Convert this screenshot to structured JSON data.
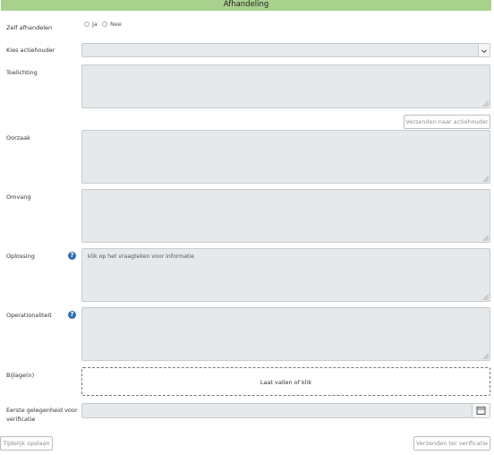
{
  "header": {
    "title": "Afhandeling"
  },
  "self_handle": {
    "label": "Zelf afhandelen",
    "options": [
      "Ja",
      "Nee"
    ]
  },
  "actionholder": {
    "label": "Kies actiehouder",
    "value": ""
  },
  "explanation": {
    "label": "Toelichting",
    "value": ""
  },
  "send_to_actionholder": {
    "label": "Verzenden naar actiehouder"
  },
  "cause": {
    "label": "Oorzaak",
    "value": ""
  },
  "scope": {
    "label": "Omvang",
    "value": ""
  },
  "solution": {
    "label": "Oplossing",
    "placeholder": "klik op het vraagteken voor informatie"
  },
  "operationality": {
    "label": "Operationaliteit",
    "value": ""
  },
  "attachments": {
    "label": "Bijlage(n)",
    "dropzone_text": "Laat vallen of klik"
  },
  "first_verification": {
    "label": "Eerste gelegenheid voor verificatie",
    "value": ""
  },
  "footer": {
    "save_temp": "Tijdelijk opslaan",
    "send_verification": "Verzenden ter verificatie"
  },
  "icons": {
    "help": "question-circle-icon",
    "calendar": "calendar-icon",
    "chevron": "chevron-down-icon"
  },
  "colors": {
    "header_bg": "#a9d18e",
    "help_icon": "#2d6fb8",
    "field_bg": "#e6e9eb"
  }
}
